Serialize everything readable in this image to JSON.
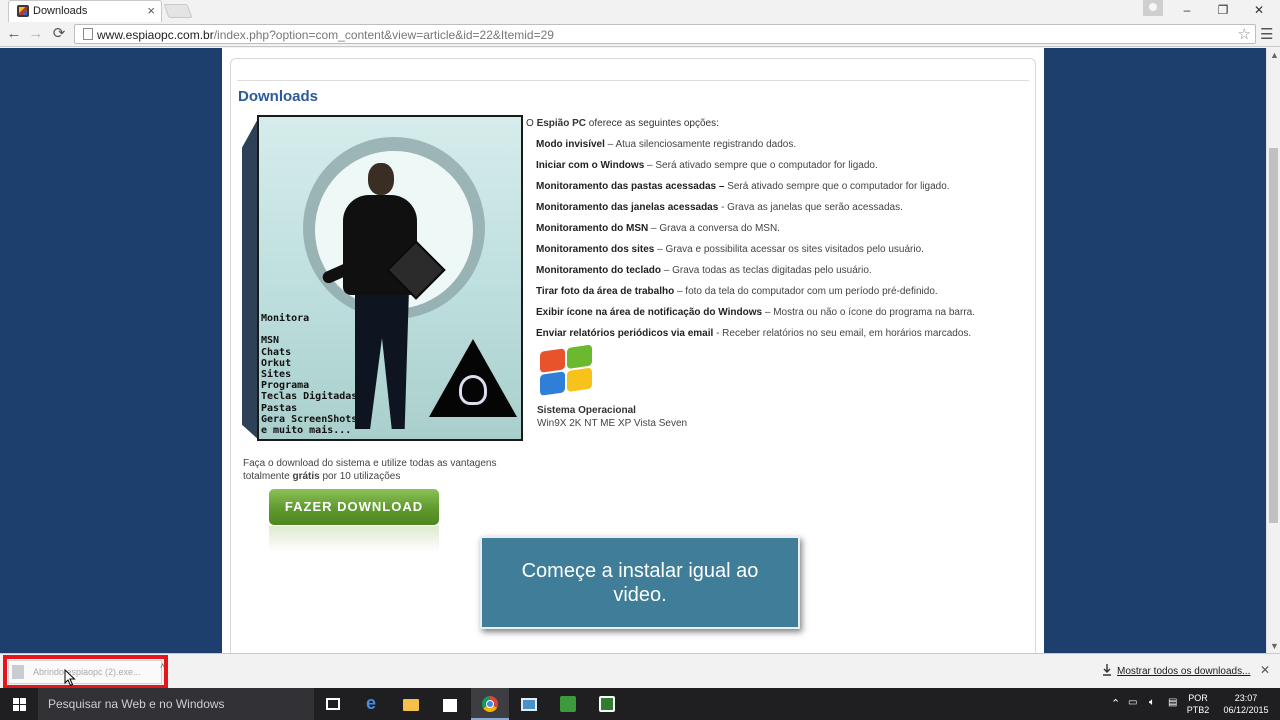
{
  "browser": {
    "tab_title": "Downloads",
    "tab_close": "×",
    "url_host": "www.espiaopc.com.br",
    "url_path": "/index.php?option=com_content&view=article&id=22&Itemid=29",
    "back": "←",
    "forward": "→",
    "reload": "⟳",
    "star": "☆",
    "menu": "☰",
    "window_minimize": "–",
    "window_restore": "❐",
    "window_close": "✕"
  },
  "page": {
    "title": "Downloads",
    "box_text": "Monitora\n\nMSN\nChats\nOrkut\nSites\nPrograma\nTeclas Digitadas\nPastas\nGera ScreenShots\ne muito mais...",
    "intro_prefix": "O ",
    "intro_brand": "Espião PC",
    "intro_suffix": " oferece as seguintes opções:",
    "options": [
      {
        "bold": "Modo invisível",
        "text": " – Atua silenciosamente registrando dados."
      },
      {
        "bold": "Iniciar com o Windows",
        "text": " – Será ativado sempre que o computador for ligado."
      },
      {
        "bold": "Monitoramento das pastas acessadas –",
        "text": " Será ativado sempre que o computador for ligado."
      },
      {
        "bold": "Monitoramento das janelas acessadas",
        "text": " - Grava as janelas que serão acessadas."
      },
      {
        "bold": "Monitoramento do MSN",
        "text": " – Grava a conversa do MSN."
      },
      {
        "bold": "Monitoramento dos sites",
        "text": " – Grava e possibilita acessar os sites visitados pelo usuário."
      },
      {
        "bold": "Monitoramento do teclado",
        "text": " – Grava todas as teclas digitadas pelo usuário."
      },
      {
        "bold": "Tirar foto da área de trabalho",
        "text": " – foto da tela do computador com um período pré-definido."
      },
      {
        "bold": "Exibir ícone na área de notificação do Windows",
        "text": " – Mostra ou não o ícone do programa na barra."
      },
      {
        "bold": "Enviar relatórios periódicos via email",
        "text": " - Receber relatórios no seu email, em horários marcados."
      }
    ],
    "os_title": "Sistema Operacional",
    "os_list": "Win9X 2K NT ME XP Vista Seven",
    "download_text_1": "Faça o download do sistema e utilize todas as vantagens",
    "download_text_2_prefix": "totalmente ",
    "download_text_2_bold": "grátis",
    "download_text_2_suffix": " por 10 utilizações",
    "download_button": "FAZER DOWNLOAD",
    "overlay": "Começe a instalar igual ao video."
  },
  "shelf": {
    "item_name": "Abrindo espiaopc (2).exe...",
    "item_caret": "˄",
    "show_all": "Mostrar todos os downloads...",
    "close": "✕"
  },
  "taskbar": {
    "search_placeholder": "Pesquisar na Web e no Windows",
    "lang_1": "POR",
    "lang_2": "PTB2",
    "time": "23:07",
    "date": "06/12/2015"
  },
  "colors": {
    "page_background": "#1c3f6e",
    "title_blue": "#2b5a9b",
    "button_green": "#5e9a2d",
    "overlay_blue": "#3f7d98",
    "highlight_red": "#e3171b"
  }
}
